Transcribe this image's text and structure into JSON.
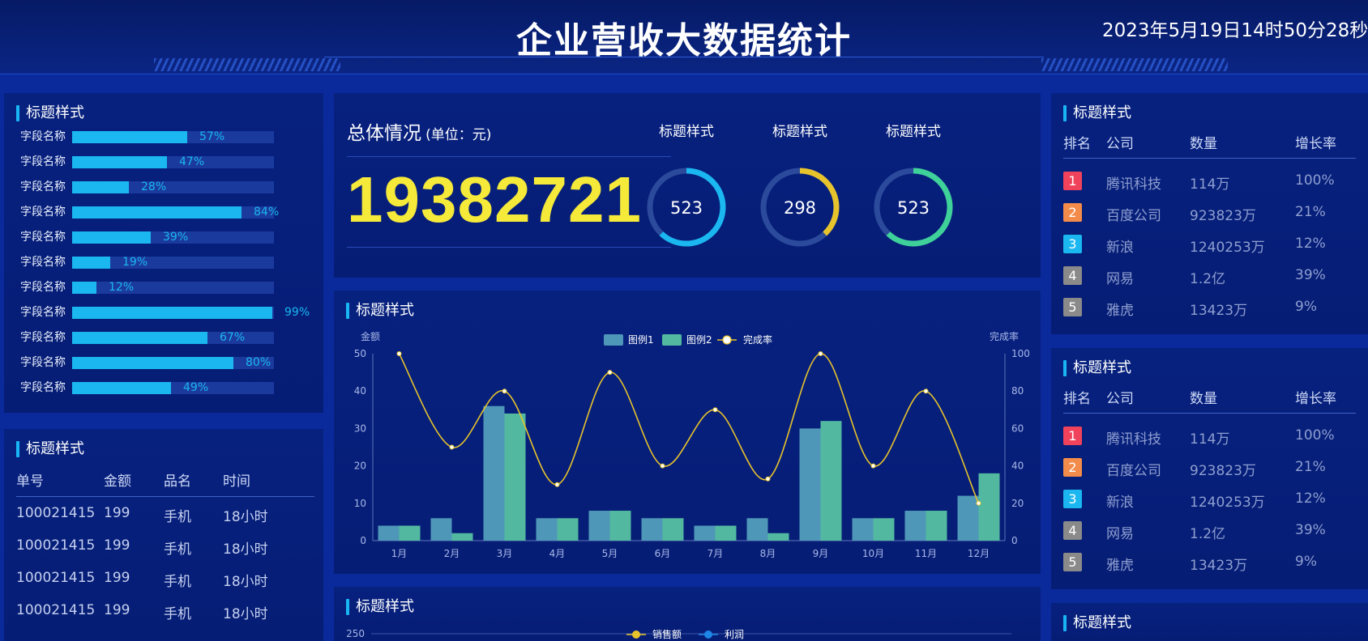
{
  "header": {
    "title": "企业营收大数据统计",
    "datetime": "2023年5月19日14时50分28秒"
  },
  "colors": {
    "bg": "#0a2a9c",
    "panel": "#07217f",
    "accent_cyan": "#1ab7f0",
    "accent_yellow": "#f5e93a",
    "gauge_gold": "#e7c32c",
    "gauge_green": "#3fd19a",
    "rank1": "#f0435b",
    "rank2": "#f38b4a",
    "rank3": "#1ab7f0",
    "rank_other": "#8a8a8a"
  },
  "bar_list": {
    "title": "标题样式",
    "items": [
      {
        "label": "字段名称",
        "value": 57,
        "pct": "57%"
      },
      {
        "label": "字段名称",
        "value": 47,
        "pct": "47%"
      },
      {
        "label": "字段名称",
        "value": 28,
        "pct": "28%"
      },
      {
        "label": "字段名称",
        "value": 84,
        "pct": "84%"
      },
      {
        "label": "字段名称",
        "value": 39,
        "pct": "39%"
      },
      {
        "label": "字段名称",
        "value": 19,
        "pct": "19%"
      },
      {
        "label": "字段名称",
        "value": 12,
        "pct": "12%"
      },
      {
        "label": "字段名称",
        "value": 99,
        "pct": "99%"
      },
      {
        "label": "字段名称",
        "value": 67,
        "pct": "67%"
      },
      {
        "label": "字段名称",
        "value": 80,
        "pct": "80%"
      },
      {
        "label": "字段名称",
        "value": 49,
        "pct": "49%"
      }
    ]
  },
  "orders": {
    "title": "标题样式",
    "headers": [
      "单号",
      "金额",
      "品名",
      "时间"
    ],
    "rows": [
      [
        "100021415",
        "199",
        "手机",
        "18小时"
      ],
      [
        "100021415",
        "199",
        "手机",
        "18小时"
      ],
      [
        "100021415",
        "199",
        "手机",
        "18小时"
      ],
      [
        "100021415",
        "199",
        "手机",
        "18小时"
      ]
    ]
  },
  "overview": {
    "title": "总体情况",
    "unit": "(单位：元)",
    "total": "19382721",
    "gauges": [
      {
        "title": "标题样式",
        "value": "523",
        "fraction": 0.62,
        "color": "#1ab7f0"
      },
      {
        "title": "标题样式",
        "value": "298",
        "fraction": 0.38,
        "color": "#e7c32c"
      },
      {
        "title": "标题样式",
        "value": "523",
        "fraction": 0.62,
        "color": "#3fd19a"
      }
    ]
  },
  "combo_chart": {
    "title": "标题样式",
    "chart_data": {
      "type": "bar",
      "categories": [
        "1月",
        "2月",
        "3月",
        "4月",
        "5月",
        "6月",
        "7月",
        "8月",
        "9月",
        "10月",
        "11月",
        "12月"
      ],
      "series": [
        {
          "name": "图例1",
          "type": "bar",
          "axis": "left",
          "color": "#4f97b8",
          "values": [
            4,
            6,
            36,
            6,
            8,
            6,
            4,
            6,
            30,
            6,
            8,
            12
          ]
        },
        {
          "name": "图例2",
          "type": "bar",
          "axis": "left",
          "color": "#52b9a0",
          "values": [
            4,
            2,
            34,
            6,
            8,
            6,
            4,
            2,
            32,
            6,
            8,
            18
          ]
        },
        {
          "name": "完成率",
          "type": "line",
          "axis": "right",
          "color": "#e7c32c",
          "values": [
            100,
            50,
            80,
            30,
            90,
            40,
            70,
            33,
            100,
            40,
            80,
            20
          ]
        }
      ],
      "ylabel_left": "金额",
      "ylabel_right": "完成率",
      "ylim_left": [
        0,
        50
      ],
      "yticks_left": [
        0,
        10,
        20,
        30,
        40,
        50
      ],
      "ylim_right": [
        0,
        100
      ],
      "yticks_right": [
        0,
        20,
        40,
        60,
        80,
        100
      ],
      "legend": "top-center"
    }
  },
  "sales_chart": {
    "title": "标题样式",
    "legend": [
      {
        "name": "销售额",
        "color": "#e7c32c"
      },
      {
        "name": "利润",
        "color": "#1e86e6"
      }
    ],
    "top_tick": "250"
  },
  "rank_table_1": {
    "title": "标题样式",
    "headers": [
      "排名",
      "公司",
      "数量",
      "增长率"
    ],
    "rows": [
      {
        "rank": "1",
        "company": "腾讯科技",
        "qty": "114万",
        "growth": "100%"
      },
      {
        "rank": "2",
        "company": "百度公司",
        "qty": "923823万",
        "growth": "21%"
      },
      {
        "rank": "3",
        "company": "新浪",
        "qty": "1240253万",
        "growth": "12%"
      },
      {
        "rank": "4",
        "company": "网易",
        "qty": "1.2亿",
        "growth": "39%"
      },
      {
        "rank": "5",
        "company": "雅虎",
        "qty": "13423万",
        "growth": "9%"
      }
    ]
  },
  "rank_table_2": {
    "title": "标题样式",
    "headers": [
      "排名",
      "公司",
      "数量",
      "增长率"
    ],
    "rows": [
      {
        "rank": "1",
        "company": "腾讯科技",
        "qty": "114万",
        "growth": "100%"
      },
      {
        "rank": "2",
        "company": "百度公司",
        "qty": "923823万",
        "growth": "21%"
      },
      {
        "rank": "3",
        "company": "新浪",
        "qty": "1240253万",
        "growth": "12%"
      },
      {
        "rank": "4",
        "company": "网易",
        "qty": "1.2亿",
        "growth": "39%"
      },
      {
        "rank": "5",
        "company": "雅虎",
        "qty": "13423万",
        "growth": "9%"
      }
    ]
  },
  "rank_table_3": {
    "title": "标题样式"
  }
}
